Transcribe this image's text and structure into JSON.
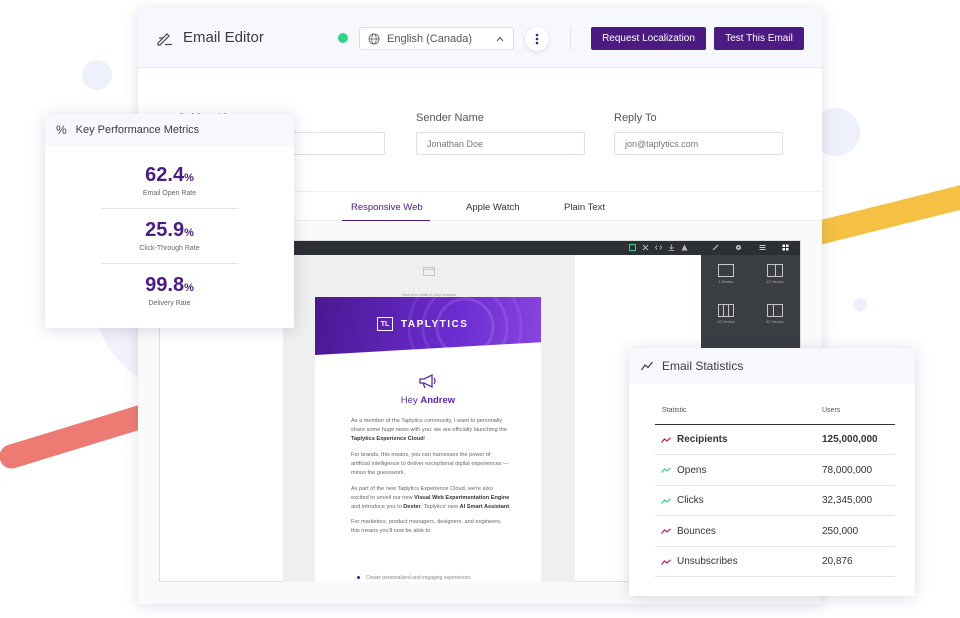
{
  "header": {
    "title": "Email Editor",
    "language": "English (Canada)",
    "request_label": "Request Localization",
    "test_label": "Test This Email",
    "status_color": "#2fd38a",
    "accent_color": "#4b1b82"
  },
  "fields": {
    "subject_label": "Subject Line",
    "sender_label": "Sender Name",
    "sender_value": "Jonathan Doe",
    "reply_label": "Reply To",
    "reply_value": "jon@taplytics.com"
  },
  "tabs": [
    {
      "label": "Responsive Web",
      "active": true
    },
    {
      "label": "Apple Watch",
      "active": false
    },
    {
      "label": "Plain Text",
      "active": false
    }
  ],
  "email_preview": {
    "view_link": "View this email in your browser",
    "logo_mark": "TL",
    "logo_text": "TAPLYTICS",
    "greeting": "Hey",
    "greeting_name": "Andrew",
    "p1": "As a member of the Taplytics community, I want to personally share some huge news with you: we are officially launching the",
    "p1_bold": "Taplytics Experience Cloud",
    "p1_end": "!",
    "p2": "For brands, this means, you can harnesses the power of artificial intelligence to deliver exceptional digital experiences — minus the guesswork.",
    "p3_a": "As part of the new Taplytics Experience Cloud, we're also excited to unveil our new",
    "p3_bold1": "Visual Web Experimentation Engine",
    "p3_b": "and introduce you to",
    "p3_bold2": "Dexter",
    "p3_c": ", Taplytics' new",
    "p3_bold3": "AI Smart Assistant",
    "p3_end": ".",
    "p4": "For marketers, product managers, designers, and engineers, this means you'll now be able to:",
    "bullet1": "Create personalized and engaging experiences"
  },
  "tool_panel": {
    "tiles": [
      "1 Section",
      "1/2 Section",
      "1/3 Section",
      "3/7 Section"
    ]
  },
  "kpi": {
    "title": "Key Performance Metrics",
    "items": [
      {
        "value": "62.4",
        "unit": "%",
        "label": "Email Open Rate"
      },
      {
        "value": "25.9",
        "unit": "%",
        "label": "Click-Through Rate"
      },
      {
        "value": "99.8",
        "unit": "%",
        "label": "Delivery Rate"
      }
    ]
  },
  "stats": {
    "title": "Email Statistics",
    "col_statistic": "Statistic",
    "col_users": "Users",
    "rows": [
      {
        "name": "Recipients",
        "value": "125,000,000",
        "color": "#c2185b"
      },
      {
        "name": "Opens",
        "value": "78,000,000",
        "color": "#2fd38a"
      },
      {
        "name": "Clicks",
        "value": "32,345,000",
        "color": "#2fd38a"
      },
      {
        "name": "Bounces",
        "value": "250,000",
        "color": "#c2185b"
      },
      {
        "name": "Unsubscribes",
        "value": "20,876",
        "color": "#c2185b"
      }
    ]
  }
}
